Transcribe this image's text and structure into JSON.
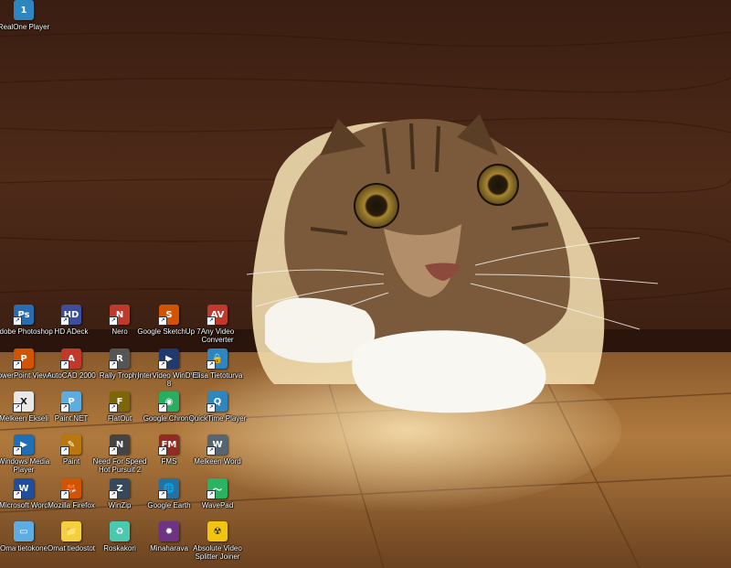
{
  "desktop": {
    "icons": [
      {
        "label": "Adobe Photoshop",
        "icon": "photoshop-icon",
        "color": "#2b6cb0",
        "glyph": "Ps"
      },
      {
        "label": "HD ADeck",
        "icon": "hd-adeck-icon",
        "color": "#3d4f9c",
        "glyph": "HD"
      },
      {
        "label": "Nero",
        "icon": "nero-icon",
        "color": "#c0392b",
        "glyph": "N"
      },
      {
        "label": "Google SketchUp 7",
        "icon": "sketchup-icon",
        "color": "#d35400",
        "glyph": "S"
      },
      {
        "label": "Any Video Converter",
        "icon": "video-converter-icon",
        "color": "#c0392b",
        "glyph": "AV"
      },
      {
        "label": "PowerPoint Viewer",
        "icon": "powerpoint-icon",
        "color": "#d35400",
        "glyph": "P"
      },
      {
        "label": "AutoCAD 2000",
        "icon": "autocad-icon",
        "color": "#c0392b",
        "glyph": "A"
      },
      {
        "label": "Rally Trophy",
        "icon": "rally-trophy-icon",
        "color": "#555555",
        "glyph": "R"
      },
      {
        "label": "InterVideo WinDVD 8",
        "icon": "windvd-icon",
        "color": "#1f3a6e",
        "glyph": "▶"
      },
      {
        "label": "Elisa Tietoturva",
        "icon": "lock-icon",
        "color": "#2e86c1",
        "glyph": "🔒"
      },
      {
        "label": "Melkeen Ekseli",
        "icon": "excel-icon",
        "color": "#e8e8e8",
        "glyph": "X"
      },
      {
        "label": "Paint.NET",
        "icon": "paintnet-icon",
        "color": "#5dade2",
        "glyph": "P"
      },
      {
        "label": "FlatOut",
        "icon": "flatout-icon",
        "color": "#7d6608",
        "glyph": "F"
      },
      {
        "label": "Google Chrome",
        "icon": "chrome-icon",
        "color": "#27ae60",
        "glyph": "◉"
      },
      {
        "label": "QuickTime Player",
        "icon": "quicktime-icon",
        "color": "#2e86c1",
        "glyph": "Q"
      },
      {
        "label": "Windows Media Player",
        "icon": "media-player-icon",
        "color": "#1f6fb5",
        "glyph": "▶"
      },
      {
        "label": "Paint",
        "icon": "paint-icon",
        "color": "#b9770e",
        "glyph": "✎"
      },
      {
        "label": "Need For Speed Hot Pursuit 2",
        "icon": "nfs-icon",
        "color": "#444444",
        "glyph": "N"
      },
      {
        "label": "FMS",
        "icon": "fms-icon",
        "color": "#922b21",
        "glyph": "FM"
      },
      {
        "label": "Melkeen Word",
        "icon": "word-icon",
        "color": "#566573",
        "glyph": "W"
      },
      {
        "label": "Microsoft Word",
        "icon": "msword-icon",
        "color": "#1f4e9c",
        "glyph": "W"
      },
      {
        "label": "Mozilla Firefox",
        "icon": "firefox-icon",
        "color": "#d35400",
        "glyph": "🦊"
      },
      {
        "label": "WinZip",
        "icon": "winzip-icon",
        "color": "#34495e",
        "glyph": "Z"
      },
      {
        "label": "Google Earth",
        "icon": "google-earth-icon",
        "color": "#2471a3",
        "glyph": "🌐"
      },
      {
        "label": "WavePad",
        "icon": "wavepad-icon",
        "color": "#28b463",
        "glyph": "〜"
      },
      {
        "label": "Oma tietokone",
        "icon": "my-computer-icon",
        "color": "#5dade2",
        "glyph": "▭"
      },
      {
        "label": "Omat tiedostot",
        "icon": "my-documents-icon",
        "color": "#f4d03f",
        "glyph": "📁"
      },
      {
        "label": "Roskakori",
        "icon": "recycle-bin-icon",
        "color": "#48c9b0",
        "glyph": "♻"
      },
      {
        "label": "Minaharava",
        "icon": "minaharava-icon",
        "color": "#6c3483",
        "glyph": "✹"
      },
      {
        "label": "Absolute Video Splitter Joiner",
        "icon": "video-splitter-icon",
        "color": "#f1c40f",
        "glyph": "☢"
      },
      {
        "label": "RealOne Player",
        "icon": "realone-icon",
        "color": "#2e86c1",
        "glyph": "1"
      }
    ]
  }
}
